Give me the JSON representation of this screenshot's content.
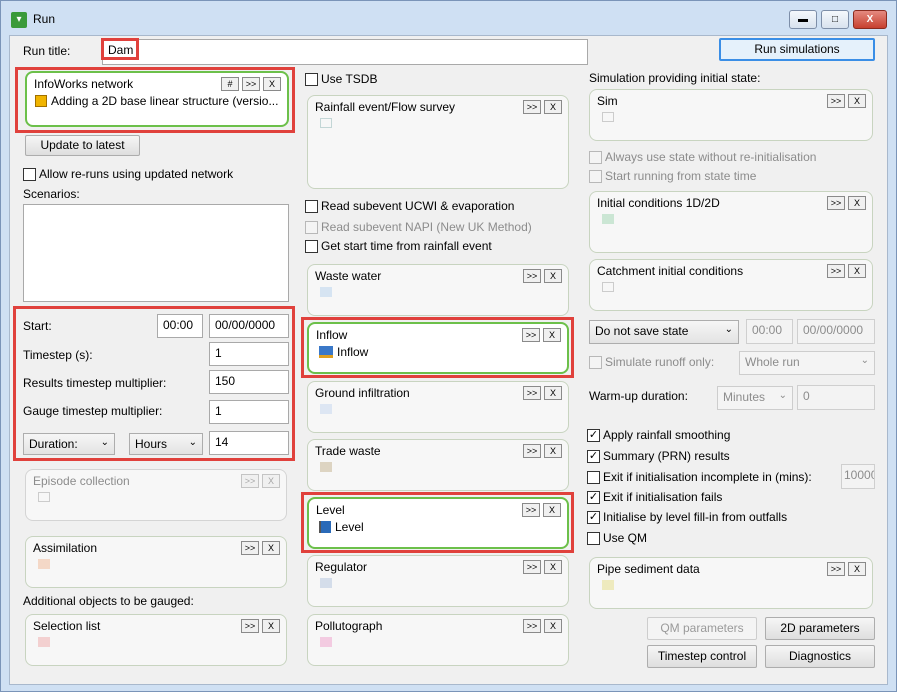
{
  "window": {
    "title": "Run",
    "minimize": "▬",
    "maximize": "□",
    "close": "X"
  },
  "run_title": {
    "label": "Run title:",
    "value": "Dam"
  },
  "run_button": "Run simulations",
  "network": {
    "title": "InfoWorks network",
    "btn_hash": "#",
    "btn_more": ">>",
    "btn_close": "X",
    "item": "Adding a 2D base linear structure (versio..."
  },
  "update_button": "Update to latest",
  "allow_reruns": "Allow re-runs using updated network",
  "scenarios_label": "Scenarios:",
  "timing": {
    "start_label": "Start:",
    "start_time": "00:00",
    "start_date": "00/00/0000",
    "timestep_label": "Timestep (s):",
    "timestep": "1",
    "results_label": "Results timestep multiplier:",
    "results": "150",
    "gauge_label": "Gauge timestep multiplier:",
    "gauge": "1",
    "duration_select": "Duration:",
    "unit_select": "Hours",
    "duration": "14"
  },
  "episode": {
    "title": "Episode collection",
    "more": ">>",
    "x": "X"
  },
  "assimilation": {
    "title": "Assimilation",
    "more": ">>",
    "x": "X"
  },
  "additional_label": "Additional objects to be gauged:",
  "selection": {
    "title": "Selection list",
    "more": ">>",
    "x": "X"
  },
  "use_tsdb": "Use TSDB",
  "rainfall": {
    "title": "Rainfall event/Flow survey",
    "more": ">>",
    "x": "X"
  },
  "read_ucwi": "Read subevent UCWI & evaporation",
  "read_napi": "Read subevent NAPI (New UK Method)",
  "get_start": "Get start time from rainfall event",
  "waste_water": {
    "title": "Waste water",
    "more": ">>",
    "x": "X"
  },
  "inflow": {
    "title": "Inflow",
    "more": ">>",
    "x": "X",
    "item": "Inflow"
  },
  "ground": {
    "title": "Ground infiltration",
    "more": ">>",
    "x": "X"
  },
  "trade": {
    "title": "Trade waste",
    "more": ">>",
    "x": "X"
  },
  "level": {
    "title": "Level",
    "more": ">>",
    "x": "X",
    "item": "Level"
  },
  "regulator": {
    "title": "Regulator",
    "more": ">>",
    "x": "X"
  },
  "pollutograph": {
    "title": "Pollutograph",
    "more": ">>",
    "x": "X"
  },
  "init_state_label": "Simulation providing initial state:",
  "sim": {
    "title": "Sim",
    "more": ">>",
    "x": "X"
  },
  "always_use": "Always use state without re-initialisation",
  "start_running": "Start running from state time",
  "initial_1d2d": {
    "title": "Initial conditions 1D/2D",
    "more": ">>",
    "x": "X"
  },
  "catchment": {
    "title": "Catchment initial conditions",
    "more": ">>",
    "x": "X"
  },
  "save_state": {
    "select": "Do not save state",
    "time": "00:00",
    "date": "00/00/0000"
  },
  "simulate_runoff": {
    "label": "Simulate runoff only:",
    "select": "Whole run"
  },
  "warmup": {
    "label": "Warm-up duration:",
    "unit": "Minutes",
    "value": "0"
  },
  "options": {
    "rain_smoothing": "Apply rainfall smoothing",
    "summary": "Summary (PRN) results",
    "exit_incomplete": "Exit if initialisation incomplete in (mins):",
    "exit_incomplete_value": "10000",
    "exit_fails": "Exit if initialisation fails",
    "init_level": "Initialise by level fill-in from outfalls",
    "use_qm": "Use QM"
  },
  "pipe_sediment": {
    "title": "Pipe sediment data",
    "more": ">>",
    "x": "X"
  },
  "buttons": {
    "qm": "QM parameters",
    "twod": "2D parameters",
    "timestep": "Timestep control",
    "diagnostics": "Diagnostics"
  },
  "check": "✓"
}
